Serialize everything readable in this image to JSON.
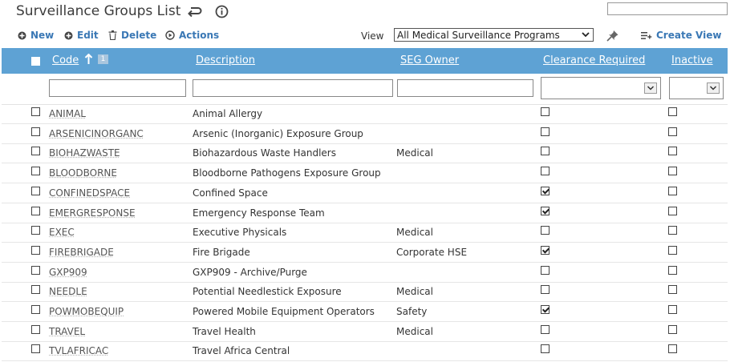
{
  "header": {
    "title": "Surveillance Groups List"
  },
  "toolbar": {
    "new_label": "New",
    "edit_label": "Edit",
    "delete_label": "Delete",
    "actions_label": "Actions",
    "view_label": "View",
    "view_value": "All Medical Surveillance Programs",
    "create_view_label": "Create View"
  },
  "columns": {
    "code": "Code",
    "sort_rank": "1",
    "description": "Description",
    "seg_owner": "SEG Owner",
    "clearance": "Clearance Required",
    "inactive": "Inactive"
  },
  "rows": [
    {
      "code": "ANIMAL",
      "description": "Animal Allergy",
      "owner": "",
      "clearance": false,
      "inactive": false
    },
    {
      "code": "ARSENICINORGANC",
      "description": "Arsenic (Inorganic) Exposure Group",
      "owner": "",
      "clearance": false,
      "inactive": false
    },
    {
      "code": "BIOHAZWASTE",
      "description": "Biohazardous Waste Handlers",
      "owner": "Medical",
      "clearance": false,
      "inactive": false
    },
    {
      "code": "BLOODBORNE",
      "description": "Bloodborne Pathogens Exposure Group",
      "owner": "",
      "clearance": false,
      "inactive": false
    },
    {
      "code": "CONFINEDSPACE",
      "description": "Confined Space",
      "owner": "",
      "clearance": true,
      "inactive": false
    },
    {
      "code": "EMERGRESPONSE",
      "description": "Emergency Response Team",
      "owner": "",
      "clearance": true,
      "inactive": false
    },
    {
      "code": "EXEC",
      "description": "Executive Physicals",
      "owner": "Medical",
      "clearance": false,
      "inactive": false
    },
    {
      "code": "FIREBRIGADE",
      "description": "Fire Brigade",
      "owner": "Corporate HSE",
      "clearance": true,
      "inactive": false
    },
    {
      "code": "GXP909",
      "description": "GXP909 - Archive/Purge",
      "owner": "",
      "clearance": false,
      "inactive": false
    },
    {
      "code": "NEEDLE",
      "description": "Potential Needlestick Exposure",
      "owner": "Medical",
      "clearance": false,
      "inactive": false
    },
    {
      "code": "POWMOBEQUIP",
      "description": "Powered Mobile Equipment Operators",
      "owner": "Safety",
      "clearance": true,
      "inactive": false
    },
    {
      "code": "TRAVEL",
      "description": "Travel Health",
      "owner": "Medical",
      "clearance": false,
      "inactive": false
    },
    {
      "code": "TVLAFRICAC",
      "description": "Travel Africa Central",
      "owner": "",
      "clearance": false,
      "inactive": false
    }
  ]
}
